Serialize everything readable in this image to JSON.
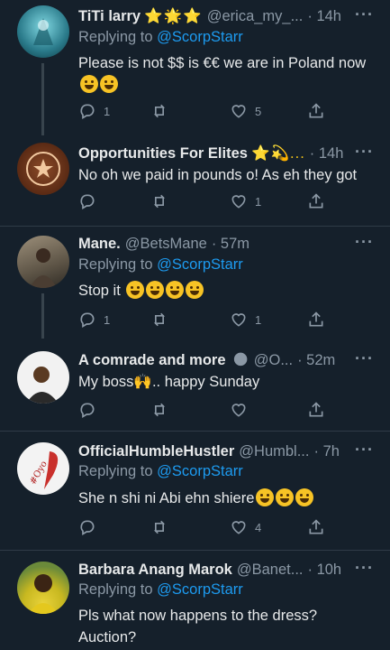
{
  "tweets": [
    {
      "name": "TiTi larry",
      "badges": "⭐🌟⭐",
      "handle": "@erica_my_...",
      "time": "· 14h",
      "replying_prefix": "Replying to",
      "replying_to": "@ScorpStarr",
      "text": "Please is not $$ is €€ we are in Poland now",
      "emoji": [
        "joy",
        "joy"
      ],
      "counts": {
        "reply": "1",
        "retweet": "",
        "like": "5"
      }
    },
    {
      "name": "Opportunities For Elites",
      "badges": "⭐💫...",
      "handle": "",
      "time": "· 14h",
      "replying_prefix": "",
      "replying_to": "",
      "text": "No oh we paid in pounds o! As eh they got",
      "emoji": [],
      "counts": {
        "reply": "",
        "retweet": "",
        "like": "1"
      }
    },
    {
      "name": "Mane.",
      "badges": "",
      "handle": "@BetsMane",
      "time": "· 57m",
      "replying_prefix": "Replying to",
      "replying_to": "@ScorpStarr",
      "text": "Stop it",
      "emoji": [
        "joy",
        "smile",
        "grimace",
        "unamused"
      ],
      "counts": {
        "reply": "1",
        "retweet": "",
        "like": "1"
      }
    },
    {
      "name": "A comrade and more",
      "badges": "🌑",
      "handle": "@O...",
      "time": "· 52m",
      "replying_prefix": "",
      "replying_to": "",
      "text": "My boss🙌.. happy Sunday",
      "emoji": [],
      "counts": {
        "reply": "",
        "retweet": "",
        "like": ""
      }
    },
    {
      "name": "OfficialHumbleHustler",
      "badges": "",
      "handle": "@Humbl...",
      "time": "· 7h",
      "replying_prefix": "Replying to",
      "replying_to": "@ScorpStarr",
      "text": "She n shi ni Abi ehn shiere",
      "emoji": [
        "joy",
        "joy",
        "joy"
      ],
      "counts": {
        "reply": "",
        "retweet": "",
        "like": "4"
      }
    },
    {
      "name": "Barbara Anang Marok",
      "badges": "",
      "handle": "@Banet...",
      "time": "· 10h",
      "replying_prefix": "Replying to",
      "replying_to": "@ScorpStarr",
      "text": "Pls what now happens to the dress? Auction?",
      "emoji": [],
      "counts": {
        "reply": "",
        "retweet": "",
        "like": ""
      }
    }
  ],
  "more_label": "···",
  "colors": {
    "background": "#15202b",
    "text": "#e7e9ea",
    "muted": "#8b98a5",
    "link": "#1d9bf0",
    "separator": "#2f3b47"
  }
}
